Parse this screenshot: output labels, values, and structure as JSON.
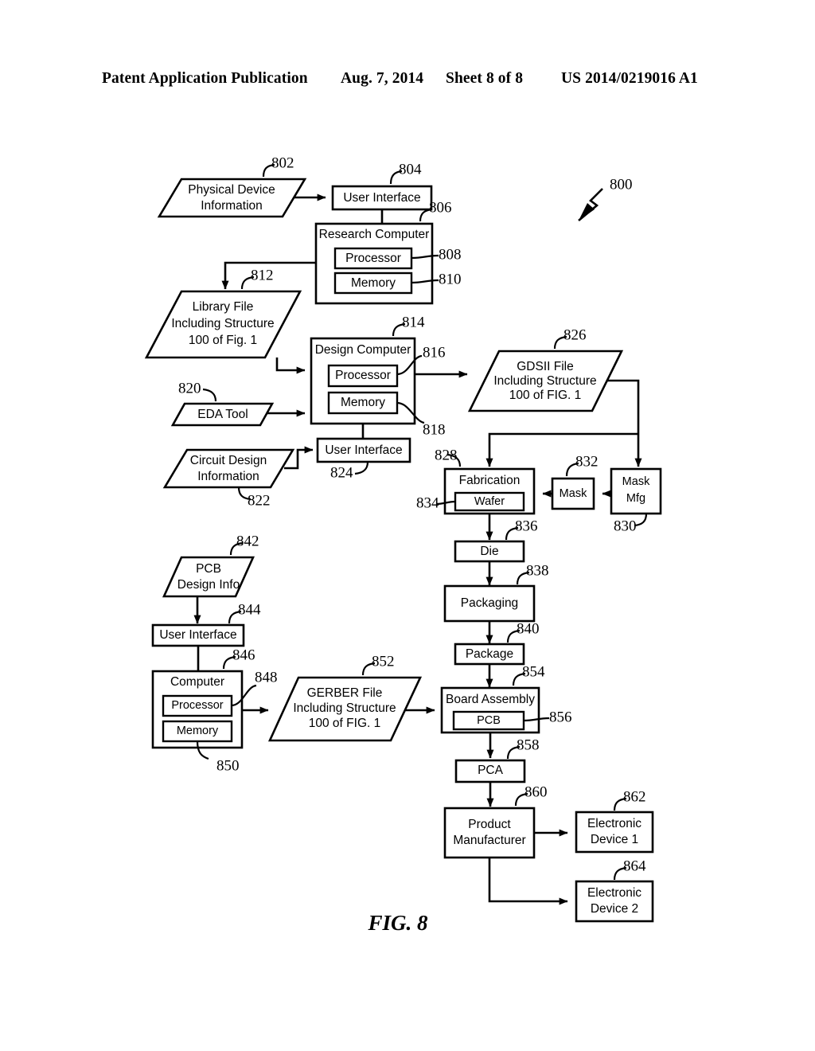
{
  "header": {
    "publication": "Patent Application Publication",
    "date": "Aug. 7, 2014",
    "sheet": "Sheet 8 of 8",
    "number": "US 2014/0219016 A1"
  },
  "figure": {
    "caption": "FIG. 8",
    "system_ref": "800"
  },
  "nodes": {
    "physical_device_information": {
      "ref": "802",
      "label_line1": "Physical Device",
      "label_line2": "Information",
      "shape": "parallelogram"
    },
    "user_interface_research": {
      "ref": "804",
      "label": "User Interface",
      "shape": "rect"
    },
    "research_computer": {
      "ref": "806",
      "label": "Research Computer",
      "shape": "rect"
    },
    "research_processor": {
      "ref": "808",
      "label": "Processor",
      "shape": "rect"
    },
    "research_memory": {
      "ref": "810",
      "label": "Memory",
      "shape": "rect"
    },
    "library_file": {
      "ref": "812",
      "label_line1": "Library File",
      "label_line2": "Including Structure",
      "label_line3": "100 of Fig. 1",
      "shape": "parallelogram"
    },
    "design_computer": {
      "ref": "814",
      "label": "Design Computer",
      "shape": "rect"
    },
    "design_processor": {
      "ref": "816",
      "label": "Processor",
      "shape": "rect"
    },
    "design_memory": {
      "ref": "818",
      "label": "Memory",
      "shape": "rect"
    },
    "eda_tool": {
      "ref": "820",
      "label": "EDA Tool",
      "shape": "parallelogram"
    },
    "circuit_design_information": {
      "ref": "822",
      "label_line1": "Circuit Design",
      "label_line2": "Information",
      "shape": "parallelogram"
    },
    "user_interface_design": {
      "ref": "824",
      "label": "User Interface",
      "shape": "rect"
    },
    "gdsii_file": {
      "ref": "826",
      "label_line1": "GDSII File",
      "label_line2": "Including Structure",
      "label_line3": "100 of FIG. 1",
      "shape": "parallelogram"
    },
    "fabrication": {
      "ref": "828",
      "label": "Fabrication",
      "shape": "rect"
    },
    "mask_mfg": {
      "ref": "830",
      "label_line1": "Mask",
      "label_line2": "Mfg",
      "shape": "rect"
    },
    "mask": {
      "ref": "832",
      "label": "Mask",
      "shape": "rect"
    },
    "wafer": {
      "ref": "834",
      "label": "Wafer",
      "shape": "rect"
    },
    "die": {
      "ref": "836",
      "label": "Die",
      "shape": "rect"
    },
    "packaging": {
      "ref": "838",
      "label": "Packaging",
      "shape": "rect"
    },
    "package": {
      "ref": "840",
      "label": "Package",
      "shape": "rect"
    },
    "pcb_design_info": {
      "ref": "842",
      "label_line1": "PCB",
      "label_line2": "Design Info",
      "shape": "parallelogram"
    },
    "user_interface_pcb": {
      "ref": "844",
      "label": "User Interface",
      "shape": "rect"
    },
    "computer": {
      "ref": "846",
      "label": "Computer",
      "shape": "rect"
    },
    "computer_processor": {
      "ref": "848",
      "label": "Processor",
      "shape": "rect"
    },
    "computer_memory": {
      "ref": "850",
      "label": "Memory",
      "shape": "rect"
    },
    "gerber_file": {
      "ref": "852",
      "label_line1": "GERBER File",
      "label_line2": "Including Structure",
      "label_line3": "100 of FIG. 1",
      "shape": "parallelogram"
    },
    "board_assembly": {
      "ref": "854",
      "label": "Board Assembly",
      "shape": "rect"
    },
    "pcb": {
      "ref": "856",
      "label": "PCB",
      "shape": "rect"
    },
    "pca": {
      "ref": "858",
      "label": "PCA",
      "shape": "rect"
    },
    "product_manufacturer": {
      "ref": "860",
      "label_line1": "Product",
      "label_line2": "Manufacturer",
      "shape": "rect"
    },
    "electronic_device_1": {
      "ref": "862",
      "label_line1": "Electronic",
      "label_line2": "Device 1",
      "shape": "rect"
    },
    "electronic_device_2": {
      "ref": "864",
      "label_line1": "Electronic",
      "label_line2": "Device 2",
      "shape": "rect"
    }
  },
  "colors": {
    "ink": "#000000",
    "paper": "#ffffff"
  }
}
